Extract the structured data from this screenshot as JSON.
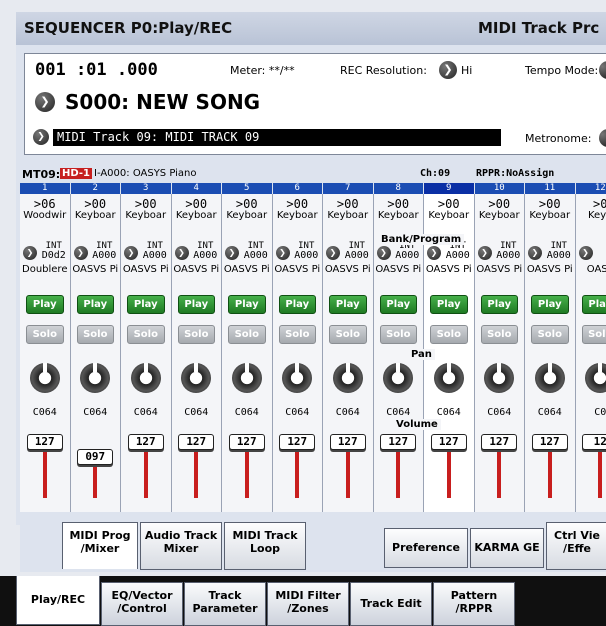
{
  "title_left": "SEQUENCER P0:Play/REC",
  "title_right": "MIDI Track Prc",
  "position": "001 :01 .000",
  "meter_label": "Meter: **/**",
  "rec_label": "REC Resolution:",
  "rec_value": "Hi",
  "tempo_label": "Tempo Mode:",
  "song_name": "S000: NEW SONG",
  "track_select": "MIDI Track 09: MIDI TRACK 09",
  "metronome_label": "Metronome:",
  "info_track": "MT09:",
  "info_hd": "HD-1",
  "info_prog": "I-A000: OASYS Piano",
  "info_ch": "Ch:09",
  "info_rppr": "RPPR:NoAssign",
  "section_bank": "Bank/Program",
  "section_pan": "Pan",
  "section_volume": "Volume",
  "play_label": "Play",
  "solo_label": "Solo",
  "tracks": [
    {
      "num": "1",
      "cat_num": ">06",
      "cat_name": "Woodwir",
      "bank_top": "INT",
      "bank_bot": "D0d2",
      "prog": "Doublere",
      "pan": "C064",
      "vol": "127",
      "fader": 1.0
    },
    {
      "num": "2",
      "cat_num": ">00",
      "cat_name": "Keyboar",
      "bank_top": "INT",
      "bank_bot": "A000",
      "prog": "OASVS Pi",
      "pan": "C064",
      "vol": "097",
      "fader": 0.76
    },
    {
      "num": "3",
      "cat_num": ">00",
      "cat_name": "Keyboar",
      "bank_top": "INT",
      "bank_bot": "A000",
      "prog": "OASVS Pi",
      "pan": "C064",
      "vol": "127",
      "fader": 1.0
    },
    {
      "num": "4",
      "cat_num": ">00",
      "cat_name": "Keyboar",
      "bank_top": "INT",
      "bank_bot": "A000",
      "prog": "OASVS Pi",
      "pan": "C064",
      "vol": "127",
      "fader": 1.0
    },
    {
      "num": "5",
      "cat_num": ">00",
      "cat_name": "Keyboar",
      "bank_top": "INT",
      "bank_bot": "A000",
      "prog": "OASVS Pi",
      "pan": "C064",
      "vol": "127",
      "fader": 1.0
    },
    {
      "num": "6",
      "cat_num": ">00",
      "cat_name": "Keyboar",
      "bank_top": "INT",
      "bank_bot": "A000",
      "prog": "OASVS Pi",
      "pan": "C064",
      "vol": "127",
      "fader": 1.0
    },
    {
      "num": "7",
      "cat_num": ">00",
      "cat_name": "Keyboar",
      "bank_top": "INT",
      "bank_bot": "A000",
      "prog": "OASVS Pi",
      "pan": "C064",
      "vol": "127",
      "fader": 1.0
    },
    {
      "num": "8",
      "cat_num": ">00",
      "cat_name": "Keyboar",
      "bank_top": "INT",
      "bank_bot": "A000",
      "prog": "OASVS Pi",
      "pan": "C064",
      "vol": "127",
      "fader": 1.0
    },
    {
      "num": "9",
      "cat_num": ">00",
      "cat_name": "Keyboar",
      "bank_top": "INT",
      "bank_bot": "A000",
      "prog": "OASVS Pi",
      "pan": "C064",
      "vol": "127",
      "fader": 1.0
    },
    {
      "num": "10",
      "cat_num": ">00",
      "cat_name": "Keyboar",
      "bank_top": "INT",
      "bank_bot": "A000",
      "prog": "OASVS Pi",
      "pan": "C064",
      "vol": "127",
      "fader": 1.0
    },
    {
      "num": "11",
      "cat_num": ">00",
      "cat_name": "Keyboar",
      "bank_top": "INT",
      "bank_bot": "A000",
      "prog": "OASVS Pi",
      "pan": "C064",
      "vol": "127",
      "fader": 1.0
    },
    {
      "num": "12",
      "cat_num": ">0",
      "cat_name": "Keyb",
      "bank_top": "I",
      "bank_bot": "A",
      "prog": "OASY",
      "pan": "C0",
      "vol": "12",
      "fader": 1.0
    }
  ],
  "selected_track": 9,
  "tabs": [
    "MIDI Prog /Mixer",
    "Audio Track Mixer",
    "MIDI Track Loop",
    "Preference",
    "KARMA GE",
    "Ctrl Vie /Effe"
  ],
  "bottom_tabs": [
    "Play/REC",
    "EQ/Vector /Control",
    "Track Parameter",
    "MIDI Filter /Zones",
    "Track Edit",
    "Pattern /RPPR"
  ]
}
